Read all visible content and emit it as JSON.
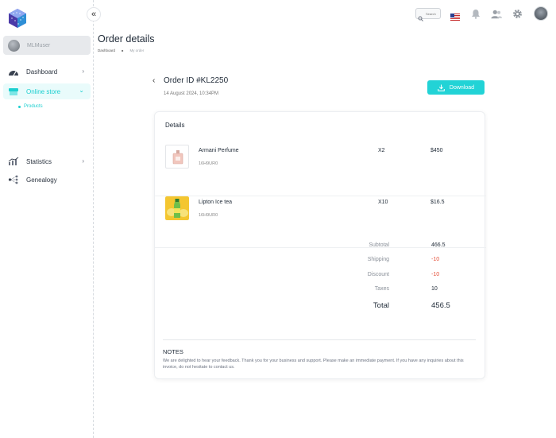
{
  "sidebar": {
    "user_name": "MLMuser",
    "nav": [
      {
        "label": "Dashboard",
        "icon": "dashboard-gauge-icon"
      },
      {
        "label": "Online store",
        "icon": "online-store-icon"
      },
      {
        "label": "Statistics",
        "icon": "statistics-chart-icon"
      },
      {
        "label": "Genealogy",
        "icon": "genealogy-tree-icon"
      }
    ],
    "sub_items": [
      {
        "label": "Products"
      }
    ]
  },
  "topbar": {
    "search_placeholder": "Search"
  },
  "page": {
    "title": "Order details",
    "breadcrumb": [
      {
        "label": "Dashboard"
      },
      {
        "label": "My order"
      }
    ]
  },
  "order": {
    "id_label": "Order ID #KL2250",
    "date": "14 August 2024, 10:34PM",
    "download_label": "Download",
    "details_title": "Details",
    "items": [
      {
        "name": "Armani Perfume",
        "sku": "16H9UR0",
        "qty": "X2",
        "price": "$450"
      },
      {
        "name": "Lipton Ice tea",
        "sku": "16H9UR0",
        "qty": "X10",
        "price": "$16.5"
      }
    ],
    "summary": [
      {
        "label": "Subtotal",
        "value": "466.5"
      },
      {
        "label": "Shipping",
        "value": "-10"
      },
      {
        "label": "Discount",
        "value": "-10"
      },
      {
        "label": "Taxes",
        "value": "10"
      },
      {
        "label": "Total",
        "value": "456.5"
      }
    ],
    "notes_title": "NOTES",
    "notes_text": "We are delighted to hear your feedback. Thank you for your business and support. Please make an immediate payment. If you have any inquiries about this invoice, do not hesitate to contact us."
  },
  "colors": {
    "accent": "#22d3d6",
    "negative": "#e5533d",
    "active_bg": "#e9fbfb"
  }
}
